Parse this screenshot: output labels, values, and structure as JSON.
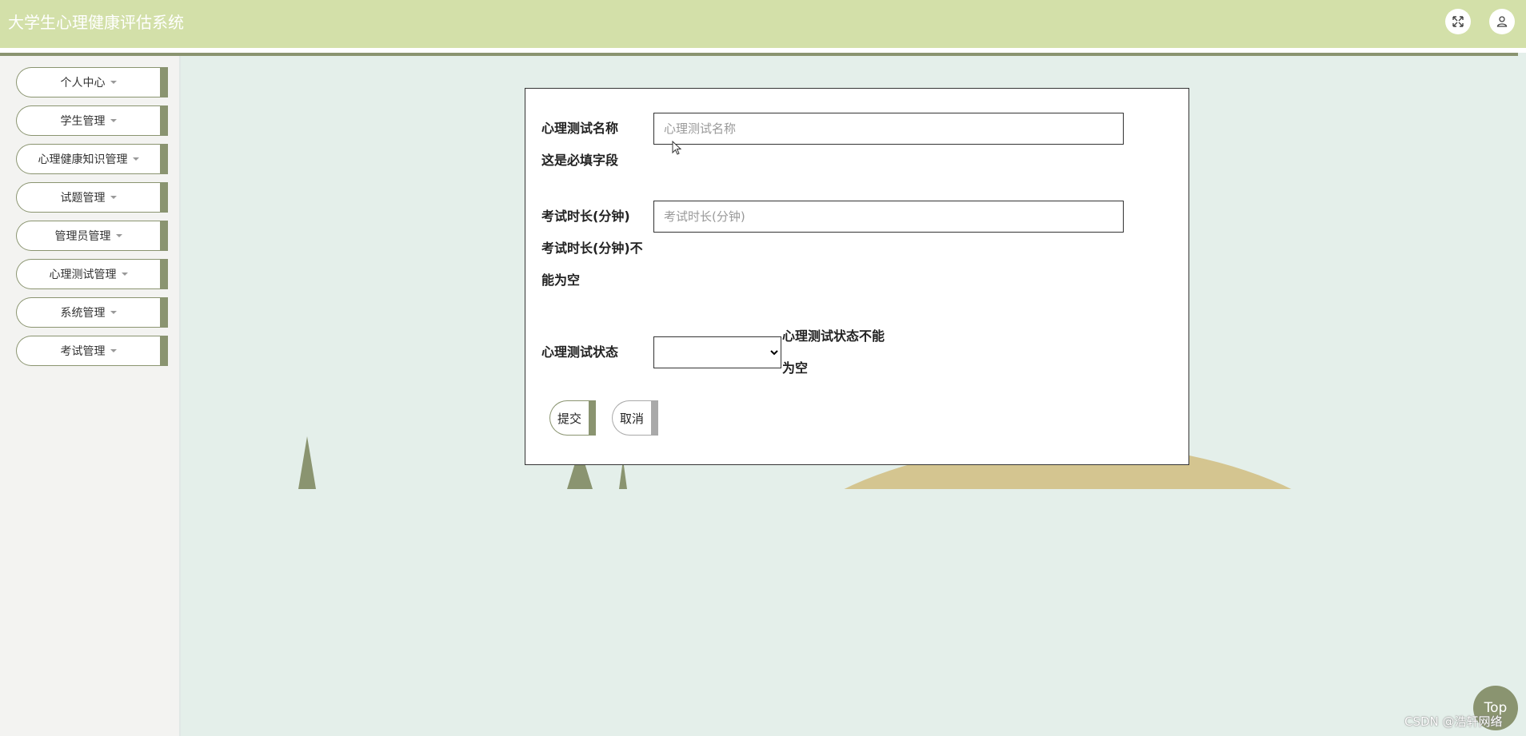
{
  "header": {
    "title": "大学生心理健康评估系统",
    "icons": [
      "fullscreen-icon",
      "user-icon"
    ]
  },
  "sidebar": {
    "items": [
      {
        "label": "个人中心"
      },
      {
        "label": "学生管理"
      },
      {
        "label": "心理健康知识管理"
      },
      {
        "label": "试题管理"
      },
      {
        "label": "管理员管理"
      },
      {
        "label": "心理测试管理"
      },
      {
        "label": "系统管理"
      },
      {
        "label": "考试管理"
      }
    ]
  },
  "form": {
    "name_label": "心理测试名称",
    "name_placeholder": "心理测试名称",
    "name_error": "这是必填字段",
    "duration_label": "考试时长(分钟)",
    "duration_placeholder": "考试时长(分钟)",
    "duration_error_line1": "考试时长(分钟)不",
    "duration_error_line2": "能为空",
    "status_label": "心理测试状态",
    "status_selected": "",
    "status_error_line1": "心理测试状态不能",
    "status_error_line2": "为空",
    "submit_label": "提交",
    "cancel_label": "取消"
  },
  "footer": {
    "top_label": "Top",
    "watermark": "CSDN @浩轩网络"
  },
  "colors": {
    "header_bg": "#d3e0a9",
    "accent": "#8a9470",
    "page_bg": "#e4efea",
    "hill": "#d4c590"
  }
}
